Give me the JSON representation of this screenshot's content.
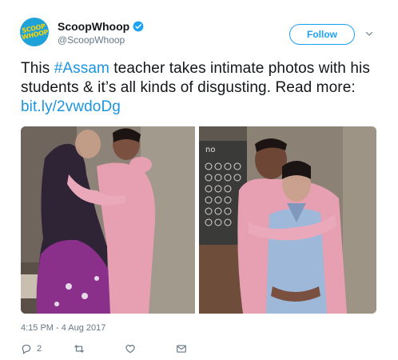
{
  "account": {
    "display_name": "ScoopWhoop",
    "handle": "@ScoopWhoop",
    "avatar_text": "SCOOP WHOOP",
    "verified": true
  },
  "follow_button_label": "Follow",
  "tweet": {
    "text_before": "This ",
    "hashtag": "#Assam",
    "text_middle": " teacher takes intimate photos with his students & it’s all kinds of disgusting. Read more: ",
    "link": "bit.ly/2vwdoDg"
  },
  "photos": [
    {
      "name": "photo-left"
    },
    {
      "name": "photo-right",
      "board_text": "no"
    }
  ],
  "timestamp": "4:15 PM - 4 Aug 2017",
  "actions": {
    "reply_count": "2",
    "retweet_count": "",
    "like_count": ""
  },
  "colors": {
    "brand_blue": "#1da1f2",
    "link_blue": "#1b95e0",
    "avatar_bg": "#1fa2d8",
    "avatar_text": "#ffd400"
  }
}
